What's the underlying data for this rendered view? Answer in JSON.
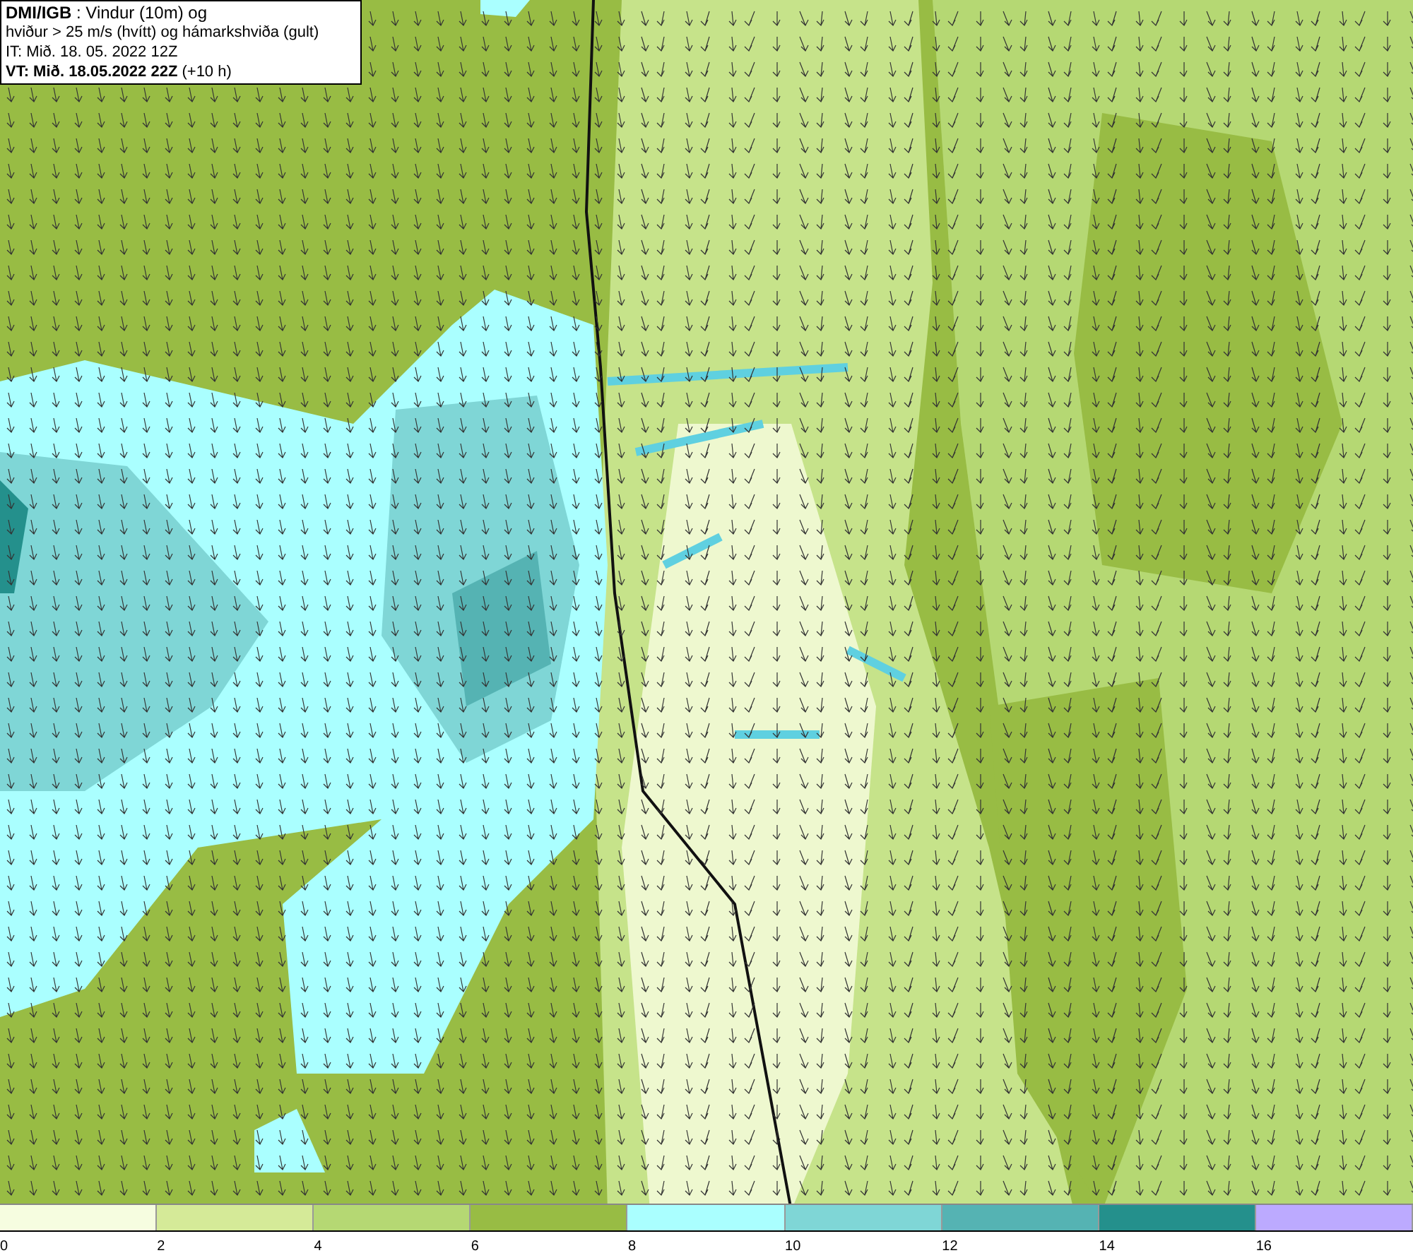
{
  "info_box": {
    "lines": [
      "**DMI/IGB** : Vindur (10m) og",
      "hviður > 25 m/s (hvítt) og hámarkshviða (gult)",
      "IT: Mið. 18. 05. 2022 12Z",
      "**VT: Mið. 18.05.2022 22Z** (+10 h)"
    ]
  },
  "color_scale": [
    {
      "label": "0",
      "color": "#f6fde0"
    },
    {
      "label": "2",
      "color": "#d5ea98"
    },
    {
      "label": "4",
      "color": "#b5d873"
    },
    {
      "label": "6",
      "color": "#98bc44"
    },
    {
      "label": "8",
      "color": "#aaffff"
    },
    {
      "label": "10",
      "color": "#7fd6d6"
    },
    {
      "label": "12",
      "color": "#55b3b3"
    },
    {
      "label": "14",
      "color": "#24908c"
    },
    {
      "label": "16",
      "color": "#bcaaff"
    }
  ]
}
